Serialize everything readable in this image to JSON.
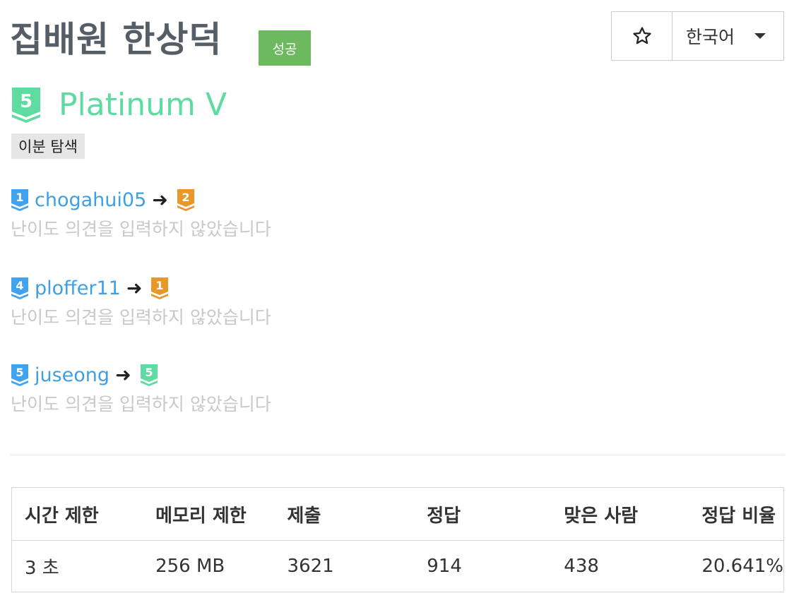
{
  "problem": {
    "title": "집배원 한상덕",
    "status_badge": "성공",
    "tier_number": "5",
    "tier_name": "Platinum V",
    "tag": "이분 탐색",
    "language": "한국어"
  },
  "colors": {
    "platinum": "#5ddba0",
    "diamond": "#41a2f0",
    "ruby_gold": "#e8972a",
    "success": "#6cb95f",
    "link": "#3ea0e4"
  },
  "opinions": [
    {
      "user": "chogahui05",
      "user_tier": "1",
      "user_tier_color": "#41a2f0",
      "vote_tier": "2",
      "vote_tier_color": "#e8972a",
      "arrow": "➜",
      "comment": "난이도 의견을 입력하지 않았습니다"
    },
    {
      "user": "ploffer11",
      "user_tier": "4",
      "user_tier_color": "#41a2f0",
      "vote_tier": "1",
      "vote_tier_color": "#e8972a",
      "arrow": "➜",
      "comment": "난이도 의견을 입력하지 않았습니다"
    },
    {
      "user": "juseong",
      "user_tier": "5",
      "user_tier_color": "#41a2f0",
      "vote_tier": "5",
      "vote_tier_color": "#5ddba0",
      "arrow": "➜",
      "comment": "난이도 의견을 입력하지 않았습니다"
    }
  ],
  "info_table": {
    "headers": [
      "시간 제한",
      "메모리 제한",
      "제출",
      "정답",
      "맞은 사람",
      "정답 비율"
    ],
    "row": [
      "3 초",
      "256 MB",
      "3621",
      "914",
      "438",
      "20.641%"
    ]
  }
}
